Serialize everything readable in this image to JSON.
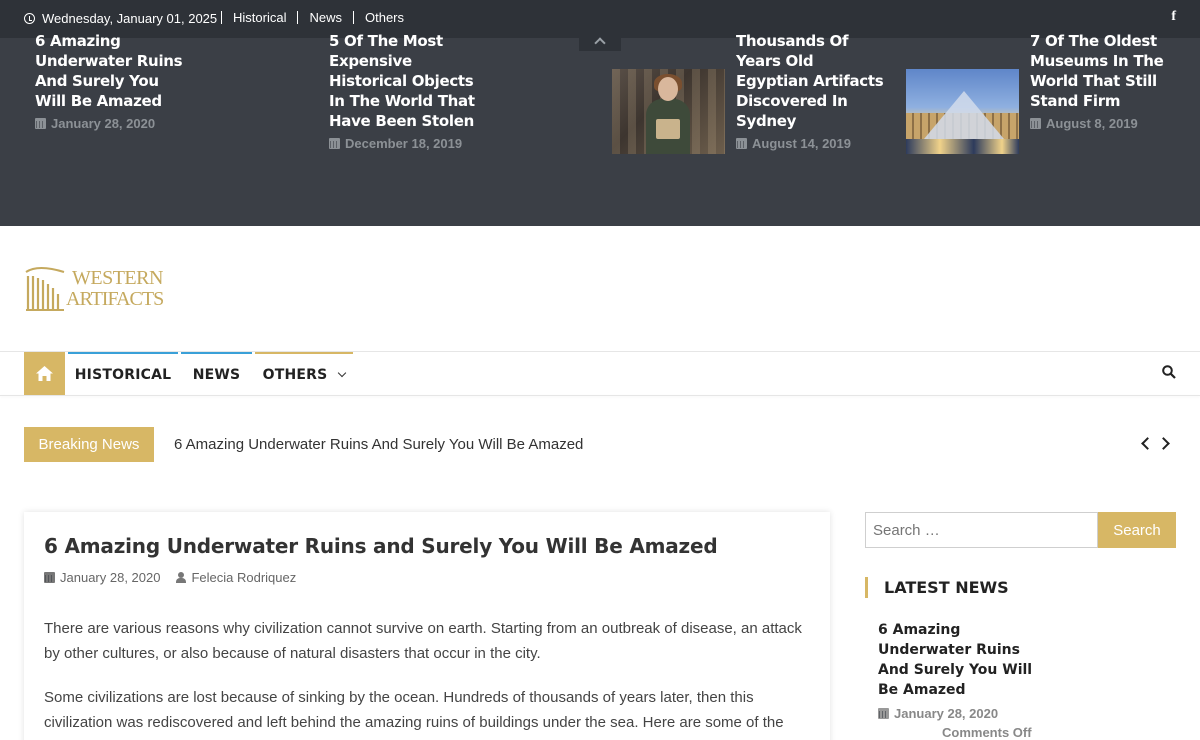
{
  "topbar": {
    "date": "Wednesday, January 01, 2025",
    "links": [
      "Historical",
      "News",
      "Others"
    ],
    "social_icon": "facebook-icon"
  },
  "featured": [
    {
      "title": "6 Amazing Underwater Ruins And Surely You Will Be Amazed",
      "date": "January 28, 2020"
    },
    {
      "title": "5 Of The Most Expensive Historical Objects In The World That Have Been Stolen",
      "date": "December 18, 2019"
    },
    {
      "title": "Thousands Of Years Old Egyptian Artifacts Discovered In Sydney",
      "date": "August 14, 2019"
    },
    {
      "title": "7 Of The Oldest Museums In The World That Still Stand Firm",
      "date": "August 8, 2019"
    }
  ],
  "logo": {
    "line1": "WESTERN",
    "line2": "ARTIFACTS"
  },
  "nav": {
    "items": [
      "HISTORICAL",
      "NEWS",
      "OTHERS"
    ]
  },
  "breaking": {
    "label": "Breaking News",
    "text": "6 Amazing Underwater Ruins And Surely You Will Be Amazed"
  },
  "article": {
    "title": "6 Amazing Underwater Ruins and Surely You Will Be Amazed",
    "date": "January 28, 2020",
    "author": "Felecia Rodriquez",
    "p1": "There are various reasons why civilization cannot survive on earth. Starting from an outbreak of disease, an attack by other cultures, or also because of natural disasters that occur in the city.",
    "p2": "Some civilizations are lost because of sinking by the ocean. Hundreds of thousands of years later, then this civilization was rediscovered and left behind the amazing ruins of buildings under the sea. Here are some of the"
  },
  "sidebar": {
    "search_placeholder": "Search …",
    "search_button": "Search",
    "latest_heading": "LATEST NEWS",
    "latest_item": {
      "title": "6 Amazing Underwater Ruins And Surely You Will Be Amazed",
      "date": "January 28, 2020",
      "comments": "Comments Off"
    }
  },
  "colors": {
    "accent": "#d7b765",
    "dark_bar": "#2e3238",
    "featured_bg": "#3b3f46",
    "nav_blue": "#3aa0d8"
  }
}
